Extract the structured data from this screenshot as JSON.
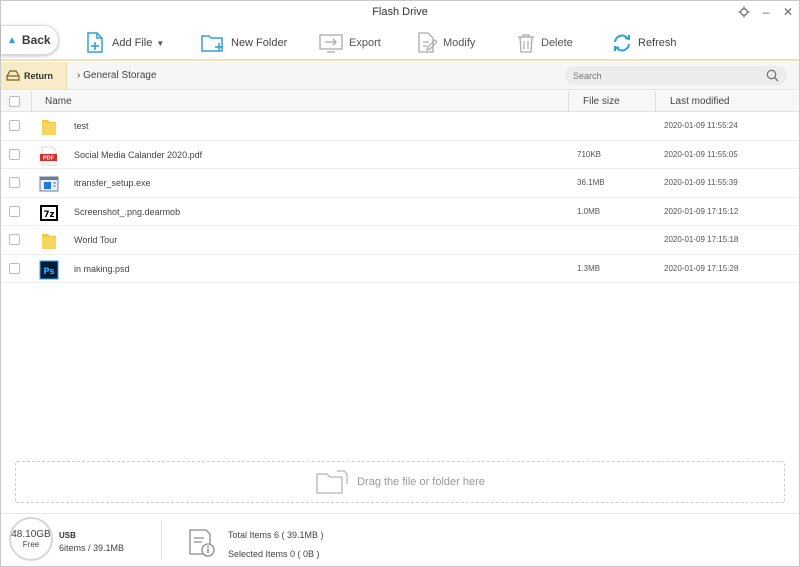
{
  "window": {
    "title": "Flash Drive"
  },
  "toolbar": {
    "back_label": "Back",
    "add_file_label": "Add File",
    "new_folder_label": "New Folder",
    "export_label": "Export",
    "modify_label": "Modify",
    "delete_label": "Delete",
    "refresh_label": "Refresh"
  },
  "nav": {
    "return_label": "Return",
    "breadcrumb": "General Storage",
    "search_placeholder": "Search"
  },
  "table": {
    "headers": {
      "name": "Name",
      "size": "File size",
      "modified": "Last modified"
    },
    "rows": [
      {
        "name": "test",
        "size": "",
        "modified": "2020-01-09 11:55:24",
        "icon": "folder-icon"
      },
      {
        "name": "Social Media Calander 2020.pdf",
        "size": "710KB",
        "modified": "2020-01-09 11:55:05",
        "icon": "pdf-icon"
      },
      {
        "name": "itransfer_setup.exe",
        "size": "36.1MB",
        "modified": "2020-01-09 11:55:39",
        "icon": "exe-icon"
      },
      {
        "name": "Screenshot_.png.dearmob",
        "size": "1.0MB",
        "modified": "2020-01-09 17:15:12",
        "icon": "7z-icon"
      },
      {
        "name": "World Tour",
        "size": "",
        "modified": "2020-01-09 17:15:18",
        "icon": "folder-icon"
      },
      {
        "name": "in making.psd",
        "size": "1.3MB",
        "modified": "2020-01-09 17:15:28",
        "icon": "psd-icon"
      }
    ]
  },
  "dropzone": {
    "text": "Drag the file or folder here"
  },
  "status": {
    "free_value": "48.10GB",
    "free_label": "Free",
    "device": "USB",
    "device_info": "6items / 39.1MB",
    "total_items": "Total Items 6 ( 39.1MB )",
    "selected_items": "Selected Items 0 ( 0B )"
  },
  "colors": {
    "accent": "#2aa3dc",
    "return_bg": "#f7ecc7",
    "toolbar_border": "#efe2b8",
    "folder": "#f5c842"
  }
}
